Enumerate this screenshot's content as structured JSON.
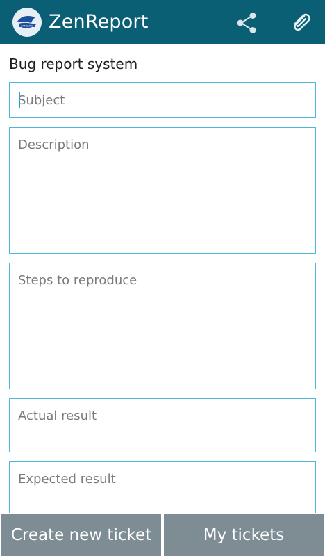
{
  "app_bar": {
    "title": "ZenReport",
    "logo_icon": "samsung-logo-icon",
    "share_icon": "share-icon",
    "attach_icon": "paperclip-icon",
    "background_color": "#0b5f74"
  },
  "form": {
    "section_title": "Bug report system",
    "subject_placeholder": "Subject",
    "description_placeholder": "Description",
    "steps_placeholder": "Steps to reproduce",
    "actual_placeholder": "Actual result",
    "expected_placeholder": "Expected result",
    "border_color": "#4cb6dc"
  },
  "bottom_bar": {
    "create_label": "Create new ticket",
    "tickets_label": "My tickets",
    "button_color": "#7e8c94"
  }
}
